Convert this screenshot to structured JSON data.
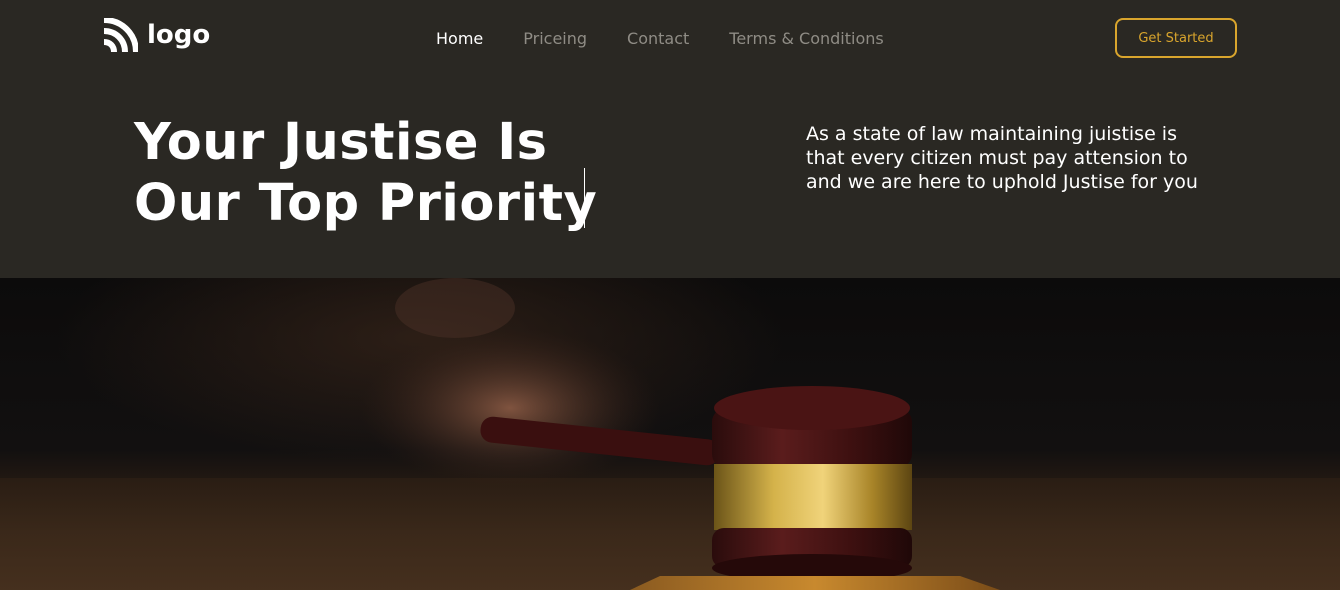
{
  "brand": {
    "logo_text": "logo",
    "logo_icon": "signal-icon"
  },
  "nav": {
    "items": [
      {
        "label": "Home",
        "active": true
      },
      {
        "label": "Priceing",
        "active": false
      },
      {
        "label": "Contact",
        "active": false
      },
      {
        "label": "Terms & Conditions",
        "active": false
      }
    ],
    "cta_label": "Get Started"
  },
  "hero": {
    "title_line1": "Your Justise Is",
    "title_line2": "Our Top Priority",
    "description": "As a state of law maintaining juistise is that every citizen must pay attension to and we are here to uphold Justise for you"
  },
  "image": {
    "subject": "gavel-photo"
  },
  "colors": {
    "background": "#2a2823",
    "accent": "#d9a52d",
    "nav_inactive": "#8f8c85",
    "text": "#ffffff"
  }
}
